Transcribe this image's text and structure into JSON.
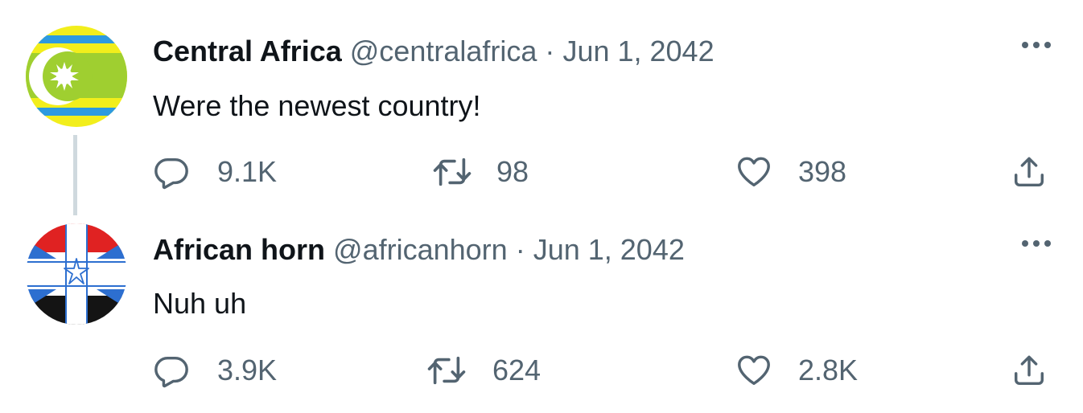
{
  "tweets": [
    {
      "display_name": "Central Africa",
      "handle": "@centralafrica",
      "separator": "·",
      "date": "Jun 1, 2042",
      "text": "Were the newest country!",
      "replies": "9.1K",
      "retweets": "98",
      "likes": "398"
    },
    {
      "display_name": "African horn",
      "handle": "@africanhorn",
      "separator": "·",
      "date": "Jun 1, 2042",
      "text": "Nuh uh",
      "replies": "3.9K",
      "retweets": "624",
      "likes": "2.8K"
    }
  ],
  "colors": {
    "text_primary": "#0f1419",
    "text_secondary": "#536471",
    "thread_line": "#cfd9de"
  },
  "icons": {
    "reply": "reply-icon",
    "retweet": "retweet-icon",
    "like": "heart-icon",
    "share": "share-icon",
    "more": "more-icon"
  }
}
